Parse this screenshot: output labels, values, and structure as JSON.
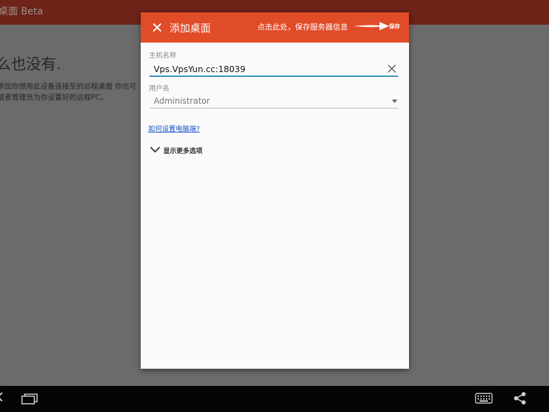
{
  "app": {
    "title": "桌面 Beta",
    "empty_title": "么也没有.",
    "empty_desc": "添加你想用此设备连接至的远程桌面 你也可或者管理员为你设置好的远程PC。"
  },
  "dialog": {
    "title": "添加桌面",
    "close_icon": "close-icon",
    "annotation": "点击此处，保存服务器信息",
    "save_label": "保存",
    "host": {
      "label": "主机名称",
      "value": "Vps.VpsYun.cc:18039"
    },
    "user": {
      "label": "用户名",
      "selected": "Administrator"
    },
    "help_link": "如何设置电脑端?",
    "more_options": "显示更多选项"
  },
  "nav": {
    "icons": [
      "back-icon",
      "recent-apps-icon",
      "keyboard-icon",
      "share-icon"
    ]
  },
  "colors": {
    "header": "#e04b28",
    "app_bar_dimmed": "#6e2418",
    "input_underline": "#2f8fb8",
    "link": "#1a55c9"
  }
}
